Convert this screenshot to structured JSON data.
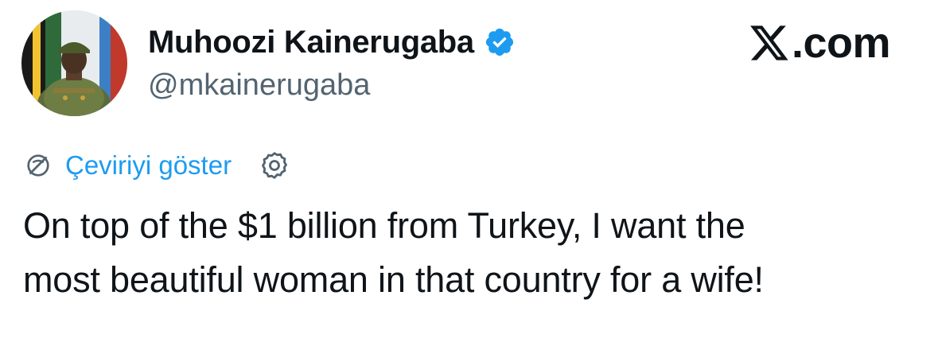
{
  "author": {
    "display_name": "Muhoozi Kainerugaba",
    "handle": "@mkainerugaba",
    "verified_icon": "verified-badge-icon",
    "avatar_icon": "profile-photo-avatar"
  },
  "brand": {
    "site_text": ".com",
    "logo_icon": "x-logo-icon"
  },
  "translate": {
    "link_label": "Çeviriyi göster",
    "globe_icon": "translate-globe-icon",
    "settings_icon": "gear-icon"
  },
  "tweet": {
    "line1": "On top of the $1 billion from Turkey, I want the",
    "line2": "most beautiful woman in that country for a wife!"
  },
  "colors": {
    "accent": "#1d9bf0",
    "text_primary": "#0f1419",
    "text_secondary": "#536471"
  }
}
